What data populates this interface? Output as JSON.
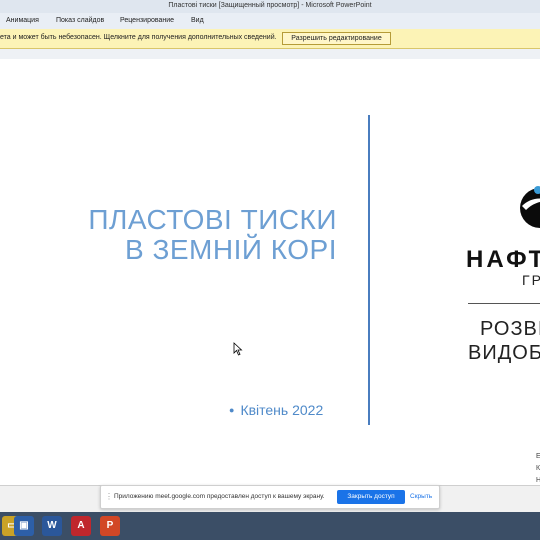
{
  "window": {
    "title": "Пластові тиски [Защищенный просмотр]  -  Microsoft PowerPoint"
  },
  "ribbon": {
    "tabs": [
      "Анимация",
      "Показ слайдов",
      "Рецензирование",
      "Вид"
    ]
  },
  "infobar": {
    "message": "ета и может быть небезопасен. Щелкните для получения дополнительных сведений.",
    "button_label": "Разрешить редактирование"
  },
  "slide": {
    "title_line1": "ПЛАСТОВІ ТИСКИ",
    "title_line2": "В ЗЕМНІЙ КОРІ",
    "date": "Квітень 2022",
    "company": "НАФТ",
    "company_sub": "ГР",
    "department_line1": "РОЗВІ",
    "department_line2": "ВИДОБ",
    "side_letters": [
      "Е",
      "К",
      "Н"
    ],
    "accent_color": "#4f8ac9",
    "divider_color": "#4a7dbf"
  },
  "share_bar": {
    "message": "Приложению meet.google.com предоставлен доступ к вашему экрану.",
    "allow_label": "Закрыть доступ",
    "hide_label": "Скрыть"
  },
  "taskbar": {
    "icons": [
      {
        "name": "folder-icon",
        "glyph": "▭",
        "color": "#c9a227"
      },
      {
        "name": "save-icon",
        "glyph": "▣",
        "color": "#2d5fa8"
      },
      {
        "name": "word-icon",
        "glyph": "W",
        "color": "#2b579a"
      },
      {
        "name": "pdf-icon",
        "glyph": "A",
        "color": "#c0272d"
      },
      {
        "name": "powerpoint-icon",
        "glyph": "P",
        "color": "#d24726"
      }
    ]
  }
}
